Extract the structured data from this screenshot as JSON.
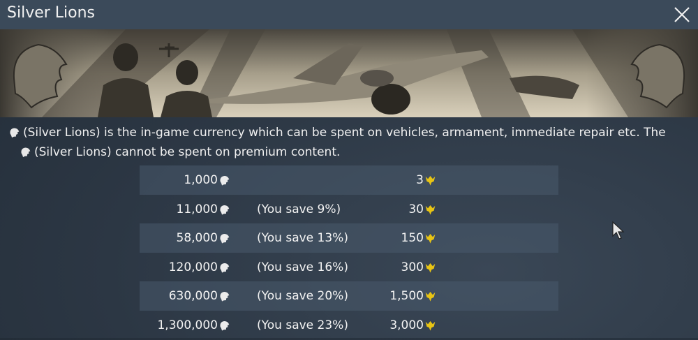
{
  "window": {
    "title": "Silver Lions"
  },
  "description": {
    "line1": "(Silver Lions) is the in-game currency which can be spent on vehicles, armament, immediate repair etc. The",
    "line2": "(Silver Lions) cannot be spent on premium content."
  },
  "packages": [
    {
      "silver_lions": "1,000",
      "savings": "",
      "golden_eagles": "3"
    },
    {
      "silver_lions": "11,000",
      "savings": "(You save 9%)",
      "golden_eagles": "30"
    },
    {
      "silver_lions": "58,000",
      "savings": "(You save 13%)",
      "golden_eagles": "150"
    },
    {
      "silver_lions": "120,000",
      "savings": "(You save 16%)",
      "golden_eagles": "300"
    },
    {
      "silver_lions": "630,000",
      "savings": "(You save 20%)",
      "golden_eagles": "1,500"
    },
    {
      "silver_lions": "1,300,000",
      "savings": "(You save 23%)",
      "golden_eagles": "3,000"
    }
  ],
  "icons": {
    "silver_lion": "silver-lion-icon",
    "golden_eagle": "golden-eagle-icon",
    "close": "close-icon"
  },
  "colors": {
    "title_bar": "#3b4a5a",
    "background": "#2c3744",
    "row_highlight": "#485a6c",
    "golden_eagle": "#e8c414"
  }
}
